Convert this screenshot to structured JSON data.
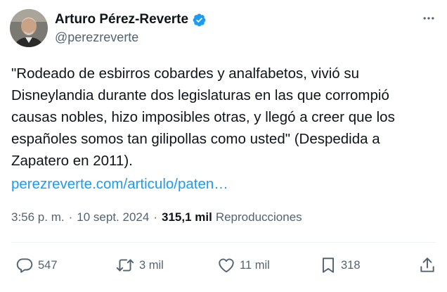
{
  "author": {
    "display_name": "Arturo Pérez-Reverte",
    "handle": "@perezreverte",
    "verified": true
  },
  "tweet": {
    "text": "\"Rodeado de esbirros cobardes y analfabetos, vivió su Disneylandia durante dos legislaturas en las que corrompió causas nobles, hizo imposibles otras, y llegó a creer que los españoles somos tan gilipollas como  usted\" (Despedida a Zapatero en 2011).",
    "link": "perezreverte.com/articulo/paten…",
    "time": "3:56 p. m.",
    "separator": "·",
    "date": "10 sept. 2024",
    "views_count": "315,1 mil",
    "views_label": "Reproducciones"
  },
  "actions": {
    "replies": "547",
    "retweets": "3 mil",
    "likes": "11 mil",
    "bookmarks": "318"
  },
  "icons": {
    "verified": "verified-badge-icon",
    "more": "more-options-icon",
    "reply": "reply-icon",
    "retweet": "retweet-icon",
    "like": "heart-icon",
    "bookmark": "bookmark-icon",
    "share": "share-icon"
  },
  "colors": {
    "accent": "#1d9bf0",
    "text": "#0f1419",
    "muted": "#536471",
    "divider": "#eff3f4"
  }
}
